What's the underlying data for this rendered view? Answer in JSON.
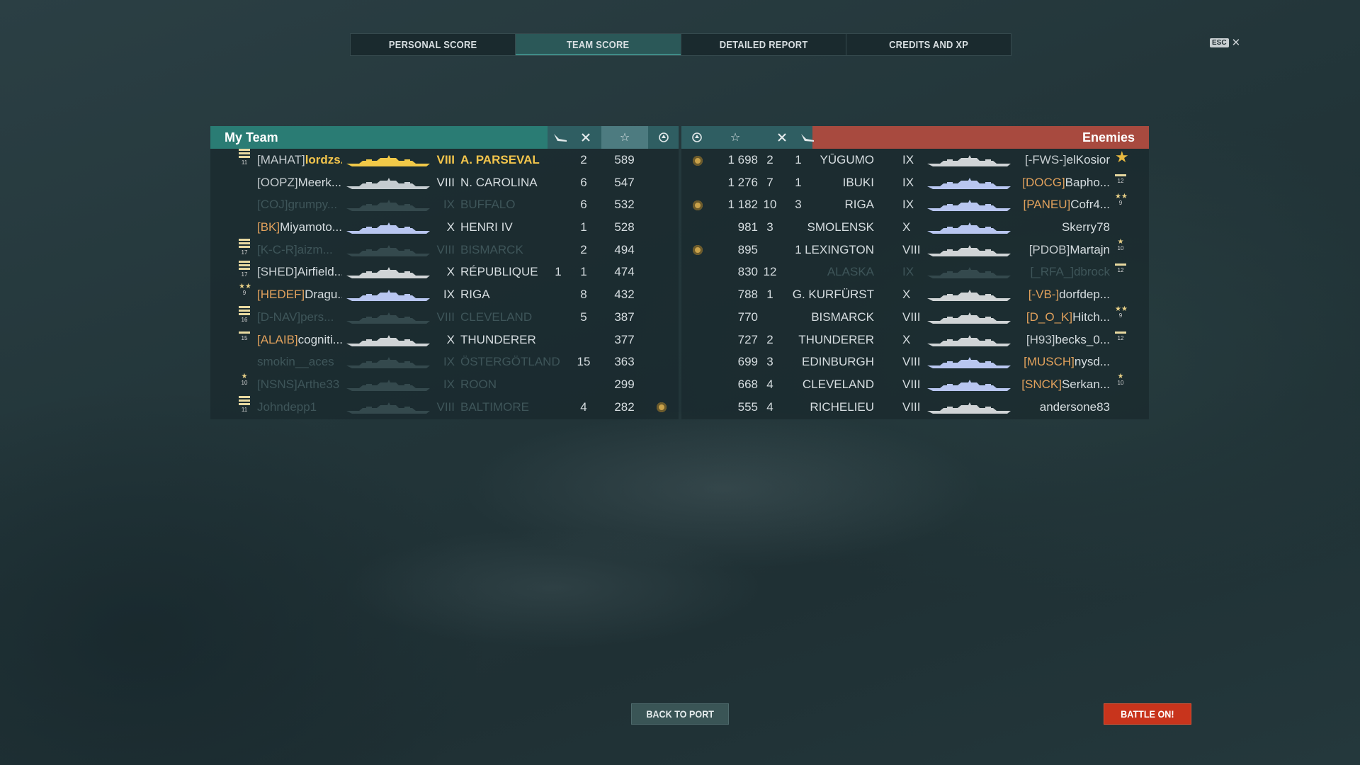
{
  "tabs": [
    {
      "label": "PERSONAL SCORE",
      "active": false
    },
    {
      "label": "TEAM SCORE",
      "active": true
    },
    {
      "label": "DETAILED REPORT",
      "active": false
    },
    {
      "label": "CREDITS AND XP",
      "active": false
    }
  ],
  "esc": {
    "key": "ESC",
    "close": "✕"
  },
  "my_team": {
    "title": "My Team",
    "rows": [
      {
        "clan": "[MAHAT]",
        "name": "lordzs...",
        "tier": "VIII",
        "ship": "A. PARSEVAL",
        "planes": "",
        "kills": "2",
        "xp": "589",
        "base": false,
        "me": true,
        "medal": "bars",
        "medal_level": "11",
        "ship_color": "#f1c948"
      },
      {
        "clan": "[OOPZ]",
        "name": "Meerk...",
        "tier": "VIII",
        "ship": "N. CAROLINA",
        "planes": "",
        "kills": "6",
        "xp": "547",
        "base": false,
        "medal": "",
        "ship_color": "#c5ccd0"
      },
      {
        "clan": "[COJ]",
        "name": "grumpy...",
        "tier": "IX",
        "ship": "BUFFALO",
        "planes": "",
        "kills": "6",
        "xp": "532",
        "base": false,
        "dead": true,
        "medal": "",
        "ship_color": "#c5ccd0"
      },
      {
        "clan": "[BK]",
        "name": "Miyamoto...",
        "tier": "X",
        "ship": "HENRI IV",
        "planes": "",
        "kills": "1",
        "xp": "528",
        "base": false,
        "clan_orange": true,
        "medal": "",
        "ship_color": "#b8c6f0"
      },
      {
        "clan": "[K-C-R]",
        "name": "aizm...",
        "tier": "VIII",
        "ship": "BISMARCK",
        "planes": "",
        "kills": "2",
        "xp": "494",
        "base": false,
        "dead": true,
        "clan_orange": true,
        "medal": "bars",
        "medal_level": "17",
        "ship_color": "#c5ccd0"
      },
      {
        "clan": "[SHED]",
        "name": "Airfield...",
        "tier": "X",
        "ship": "RÉPUBLIQUE",
        "planes": "1",
        "kills": "1",
        "xp": "474",
        "base": false,
        "medal": "bars",
        "medal_level": "17",
        "ship_color": "#d0d4d6"
      },
      {
        "clan": "[HEDEF]",
        "name": "Dragu...",
        "tier": "IX",
        "ship": "RIGA",
        "planes": "",
        "kills": "8",
        "xp": "432",
        "base": false,
        "clan_orange": true,
        "medal": "stars",
        "medal_level": "9",
        "ship_color": "#b8c6f0"
      },
      {
        "clan": "[D-NAV]",
        "name": "pers...",
        "tier": "VIII",
        "ship": "CLEVELAND",
        "planes": "",
        "kills": "5",
        "xp": "387",
        "base": false,
        "dead": true,
        "medal": "bars",
        "medal_level": "16",
        "ship_color": "#c5ccd0"
      },
      {
        "clan": "[ALAIB]",
        "name": "cogniti...",
        "tier": "X",
        "ship": "THUNDERER",
        "planes": "",
        "kills": "",
        "xp": "377",
        "base": false,
        "clan_orange": true,
        "medal": "bar",
        "medal_level": "15",
        "ship_color": "#d0d4d6"
      },
      {
        "clan": "",
        "name": "smokin__aces",
        "tier": "IX",
        "ship": "ÖSTERGÖTLAND",
        "planes": "",
        "kills": "15",
        "xp": "363",
        "base": false,
        "dead": true,
        "medal": "",
        "ship_color": "#c5ccd0"
      },
      {
        "clan": "[NSNS]",
        "name": "Arthe33",
        "tier": "IX",
        "ship": "ROON",
        "planes": "",
        "kills": "",
        "xp": "299",
        "base": false,
        "dead": true,
        "medal": "star",
        "medal_level": "10",
        "ship_color": "#c5ccd0"
      },
      {
        "clan": "",
        "name": "Johndepp1",
        "tier": "VIII",
        "ship": "BALTIMORE",
        "planes": "",
        "kills": "4",
        "xp": "282",
        "base": true,
        "dead": true,
        "medal": "bars",
        "medal_level": "11",
        "ship_color": "#c5ccd0"
      }
    ]
  },
  "enemies": {
    "title": "Enemies",
    "rows": [
      {
        "base": true,
        "xp": "1 698",
        "kills": "2",
        "planes": "1",
        "ship": "YŪGUMO",
        "tier": "IX",
        "clan": "[-FWS-]",
        "name": "elKosior",
        "medal": "big-star",
        "medal_level": "",
        "ship_color": "#d0d4d6"
      },
      {
        "base": false,
        "xp": "1 276",
        "kills": "7",
        "planes": "1",
        "ship": "IBUKI",
        "tier": "IX",
        "clan": "[DOCG]",
        "name": "Bapho...",
        "clan_orange": true,
        "medal": "bar",
        "medal_level": "12",
        "ship_color": "#b8c6f0"
      },
      {
        "base": true,
        "xp": "1 182",
        "kills": "10",
        "planes": "3",
        "ship": "RIGA",
        "tier": "IX",
        "clan": "[PANEU]",
        "name": "Cofr4...",
        "clan_orange": true,
        "medal": "stars",
        "medal_level": "9",
        "ship_color": "#b8c6f0"
      },
      {
        "base": false,
        "xp": "981",
        "kills": "3",
        "planes": "",
        "ship": "SMOLENSK",
        "tier": "X",
        "clan": "",
        "name": "Skerry78",
        "medal": "",
        "ship_color": "#b8c6f0"
      },
      {
        "base": true,
        "xp": "895",
        "kills": "",
        "planes": "1",
        "ship": "LEXINGTON",
        "tier": "VIII",
        "clan": "[PDOB]",
        "name": "Martajn",
        "medal": "star",
        "medal_level": "10",
        "ship_color": "#d0d4d6"
      },
      {
        "base": false,
        "xp": "830",
        "kills": "12",
        "planes": "",
        "ship": "ALASKA",
        "tier": "IX",
        "clan": "[_RFA_]",
        "name": "dbrock",
        "dead": true,
        "clan_orange": true,
        "medal": "bar",
        "medal_level": "12",
        "ship_color": "#c5ccd0"
      },
      {
        "base": false,
        "xp": "788",
        "kills": "1",
        "planes": "",
        "ship": "G. KURFÜRST",
        "tier": "X",
        "clan": "[-VB-]",
        "name": "dorfdep...",
        "clan_orange": true,
        "medal": "",
        "ship_color": "#d0d4d6"
      },
      {
        "base": false,
        "xp": "770",
        "kills": "",
        "planes": "",
        "ship": "BISMARCK",
        "tier": "VIII",
        "clan": "[D_O_K]",
        "name": "Hitch...",
        "clan_orange": true,
        "medal": "stars",
        "medal_level": "9",
        "ship_color": "#d0d4d6"
      },
      {
        "base": false,
        "xp": "727",
        "kills": "2",
        "planes": "",
        "ship": "THUNDERER",
        "tier": "X",
        "clan": "[H93]",
        "name": "becks_0...",
        "medal": "bar",
        "medal_level": "12",
        "ship_color": "#d0d4d6"
      },
      {
        "base": false,
        "xp": "699",
        "kills": "3",
        "planes": "",
        "ship": "EDINBURGH",
        "tier": "VIII",
        "clan": "[MUSCH]",
        "name": "nysd...",
        "clan_orange": true,
        "medal": "",
        "ship_color": "#b8c6f0"
      },
      {
        "base": false,
        "xp": "668",
        "kills": "4",
        "planes": "",
        "ship": "CLEVELAND",
        "tier": "VIII",
        "clan": "[SNCK]",
        "name": "Serkan...",
        "clan_orange": true,
        "medal": "star",
        "medal_level": "10",
        "ship_color": "#b8c6f0"
      },
      {
        "base": false,
        "xp": "555",
        "kills": "4",
        "planes": "",
        "ship": "RICHELIEU",
        "tier": "VIII",
        "clan": "",
        "name": "andersone83",
        "medal": "",
        "ship_color": "#d0d4d6"
      }
    ]
  },
  "buttons": {
    "back": "BACK TO PORT",
    "battle": "BATTLE ON!"
  }
}
